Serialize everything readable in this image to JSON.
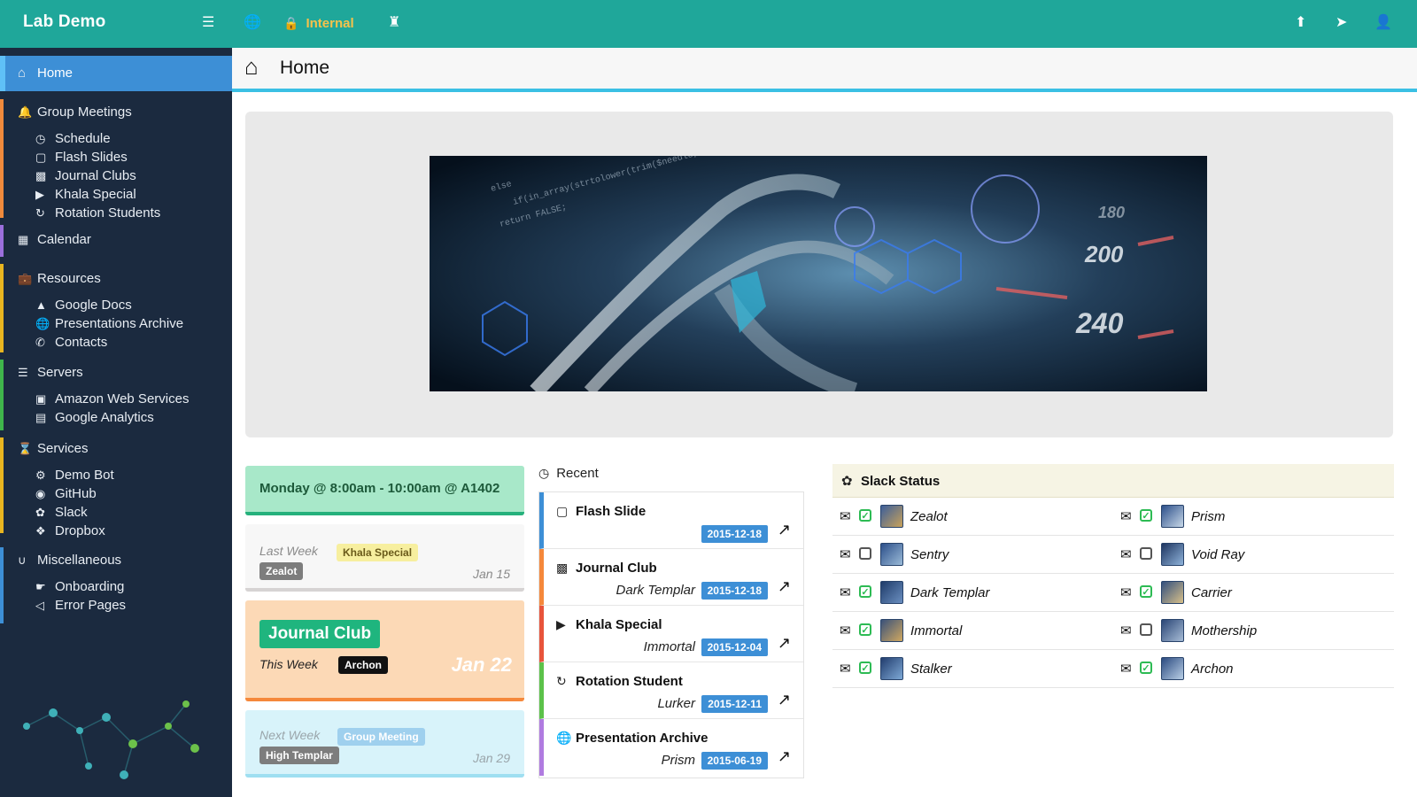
{
  "topbar": {
    "brand": "Lab Demo",
    "internal_label": "Internal",
    "icons": [
      "list-icon",
      "globe-icon",
      "lock-icon",
      "chess-icon",
      "upload-icon",
      "send-icon",
      "user-icon"
    ]
  },
  "sidebar": {
    "home": "Home",
    "groups": [
      {
        "label": "Group Meetings",
        "icon": "bell-icon",
        "color": "#f08a3c",
        "items": [
          {
            "label": "Schedule",
            "icon": "clock-icon"
          },
          {
            "label": "Flash Slides",
            "icon": "presentation-icon"
          },
          {
            "label": "Journal Clubs",
            "icon": "book-icon"
          },
          {
            "label": "Khala Special",
            "icon": "video-icon"
          },
          {
            "label": "Rotation Students",
            "icon": "retweet-icon"
          }
        ]
      },
      {
        "label": "Calendar",
        "icon": "calendar-icon",
        "color": "#9b6fdc",
        "items": []
      },
      {
        "label": "Resources",
        "icon": "briefcase-icon",
        "color": "#e8b520",
        "items": [
          {
            "label": "Google Docs",
            "icon": "drive-icon"
          },
          {
            "label": "Presentations Archive",
            "icon": "globe-icon"
          },
          {
            "label": "Contacts",
            "icon": "phone-icon"
          }
        ]
      },
      {
        "label": "Servers",
        "icon": "server-icon",
        "color": "#3fb54b",
        "items": [
          {
            "label": "Amazon Web Services",
            "icon": "cube-icon"
          },
          {
            "label": "Google Analytics",
            "icon": "chart-icon"
          }
        ]
      },
      {
        "label": "Services",
        "icon": "hourglass-icon",
        "color": "#e8b520",
        "items": [
          {
            "label": "Demo Bot",
            "icon": "bot-icon"
          },
          {
            "label": "GitHub",
            "icon": "github-icon"
          },
          {
            "label": "Slack",
            "icon": "slack-icon"
          },
          {
            "label": "Dropbox",
            "icon": "dropbox-icon"
          }
        ]
      },
      {
        "label": "Miscellaneous",
        "icon": "magnet-icon",
        "color": "#3d8fd6",
        "items": [
          {
            "label": "Onboarding",
            "icon": "hand-icon"
          },
          {
            "label": "Error Pages",
            "icon": "volume-off-icon"
          }
        ]
      }
    ]
  },
  "header": {
    "title": "Home"
  },
  "schedule": {
    "next": "Monday @ 8:00am - 10:00am @ A1402",
    "last_week": {
      "week": "Last Week",
      "type": "Khala Special",
      "presenter": "Zealot",
      "date": "Jan 15"
    },
    "this_week": {
      "type": "Journal Club",
      "week": "This Week",
      "presenter": "Archon",
      "date": "Jan 22"
    },
    "next_week": {
      "week": "Next Week",
      "type": "Group Meeting",
      "presenter": "High Templar",
      "date": "Jan 29"
    }
  },
  "recent": {
    "title": "Recent",
    "items": [
      {
        "name": "Flash Slide",
        "who": "",
        "date": "2015-12-18",
        "icon": "presentation-icon",
        "color": "#3d8fd6"
      },
      {
        "name": "Journal Club",
        "who": "Dark Templar",
        "date": "2015-12-18",
        "icon": "book-icon",
        "color": "#f5883b"
      },
      {
        "name": "Khala Special",
        "who": "Immortal",
        "date": "2015-12-04",
        "icon": "video-icon",
        "color": "#e8543b"
      },
      {
        "name": "Rotation Student",
        "who": "Lurker",
        "date": "2015-12-11",
        "icon": "retweet-icon",
        "color": "#5cc24a"
      },
      {
        "name": "Presentation Archive",
        "who": "Prism",
        "date": "2015-06-19",
        "icon": "globe-icon",
        "color": "#b07be0"
      }
    ]
  },
  "slack": {
    "title": "Slack Status",
    "left": [
      {
        "name": "Zealot",
        "active": true
      },
      {
        "name": "Sentry",
        "active": false
      },
      {
        "name": "Dark Templar",
        "active": true
      },
      {
        "name": "Immortal",
        "active": true
      },
      {
        "name": "Stalker",
        "active": true
      }
    ],
    "right": [
      {
        "name": "Prism",
        "active": true
      },
      {
        "name": "Void Ray",
        "active": false
      },
      {
        "name": "Carrier",
        "active": true
      },
      {
        "name": "Mothership",
        "active": false
      },
      {
        "name": "Archon",
        "active": true
      }
    ]
  },
  "colors": {
    "accent": "#1fa79a",
    "sidebar": "#1b2a3f",
    "home_active": "#3d8fd6",
    "badge_blue": "#3d8fd6",
    "internal": "#f5c24b"
  }
}
